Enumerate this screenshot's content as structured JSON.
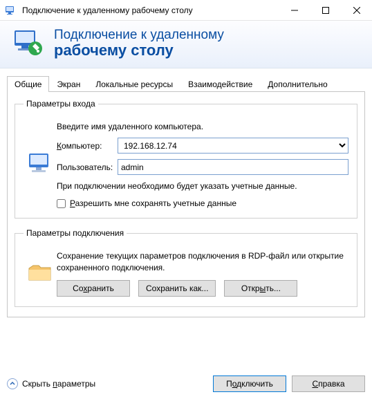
{
  "window": {
    "title": "Подключение к удаленному рабочему столу"
  },
  "header": {
    "line1": "Подключение к удаленному",
    "line2": "рабочему столу"
  },
  "tabs": {
    "general": "Общие",
    "display": "Экран",
    "local_resources": "Локальные ресурсы",
    "experience": "Взаимодействие",
    "advanced": "Дополнительно"
  },
  "login": {
    "legend": "Параметры входа",
    "instruction": "Введите имя удаленного компьютера.",
    "computer_label_pre": "К",
    "computer_label_rest": "омпьютер:",
    "computer_value": "192.168.12.74",
    "user_label": "Пользователь:",
    "user_value": "admin",
    "credentials_note": "При подключении необходимо будет указать учетные данные.",
    "save_creds_pre": "Р",
    "save_creds_rest": "азрешить мне сохранять учетные данные"
  },
  "connection_settings": {
    "legend": "Параметры подключения",
    "description": "Сохранение текущих параметров подключения в RDP-файл или открытие сохраненного подключения.",
    "save_pre": "Со",
    "save_u": "х",
    "save_rest": "ранить",
    "saveas_label": "Сохранить как...",
    "open_pre": "Откр",
    "open_u": "ы",
    "open_rest": "ть..."
  },
  "footer": {
    "hide_pre": "Скрыть ",
    "hide_u": "п",
    "hide_rest": "араметры",
    "connect_pre": "П",
    "connect_u": "о",
    "connect_rest": "дключить",
    "help_pre": "",
    "help_u": "С",
    "help_rest": "правка"
  }
}
